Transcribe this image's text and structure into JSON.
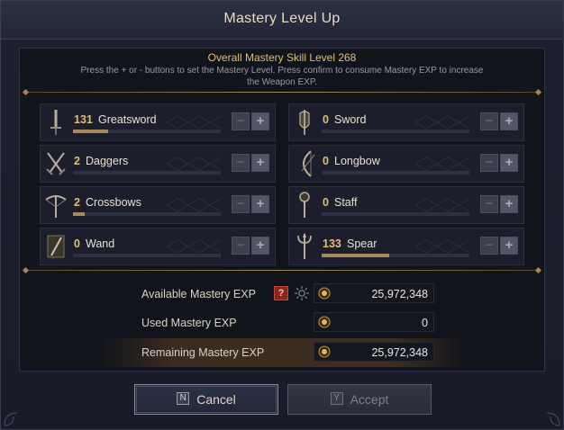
{
  "dialog": {
    "title": "Mastery Level Up",
    "close_icon": "close-icon"
  },
  "header": {
    "overall": "Overall Mastery Skill Level 268",
    "instructions": "Press the + or - buttons to set the Mastery Level. Press confirm to consume Mastery EXP to increase the Weapon EXP."
  },
  "weapons": [
    {
      "level": "131",
      "name": "Greatsword",
      "icon": "greatsword-icon",
      "progress": 0.24
    },
    {
      "level": "0",
      "name": "Sword",
      "icon": "sword-icon",
      "progress": 0
    },
    {
      "level": "2",
      "name": "Daggers",
      "icon": "daggers-icon",
      "progress": 0
    },
    {
      "level": "0",
      "name": "Longbow",
      "icon": "longbow-icon",
      "progress": 0
    },
    {
      "level": "2",
      "name": "Crossbows",
      "icon": "crossbow-icon",
      "progress": 0.08
    },
    {
      "level": "0",
      "name": "Staff",
      "icon": "staff-icon",
      "progress": 0
    },
    {
      "level": "0",
      "name": "Wand",
      "icon": "wand-icon",
      "progress": 0
    },
    {
      "level": "133",
      "name": "Spear",
      "icon": "spear-icon",
      "progress": 0.46
    }
  ],
  "controls": {
    "minus": "−",
    "plus": "+"
  },
  "exp": {
    "available_label": "Available Mastery EXP",
    "available_value": "25,972,348",
    "help_label": "?",
    "used_label": "Used Mastery EXP",
    "used_value": "0",
    "remaining_label": "Remaining Mastery EXP",
    "remaining_value": "25,972,348"
  },
  "buttons": {
    "cancel_key": "N",
    "cancel_label": "Cancel",
    "accept_key": "Y",
    "accept_label": "Accept"
  },
  "colors": {
    "accent_gold": "#e3bd7a",
    "progress_fill": "#a98a5a",
    "help_red": "#8a2318"
  }
}
